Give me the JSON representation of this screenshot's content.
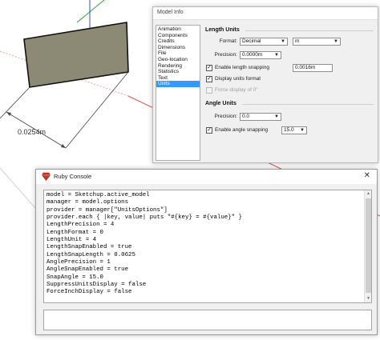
{
  "viewport": {
    "dimension_label": "0.0254m"
  },
  "model_info": {
    "title": "Model Info",
    "categories": [
      {
        "label": "Animation",
        "selected": false
      },
      {
        "label": "Components",
        "selected": false
      },
      {
        "label": "Credits",
        "selected": false
      },
      {
        "label": "Dimensions",
        "selected": false
      },
      {
        "label": "File",
        "selected": false
      },
      {
        "label": "Geo-location",
        "selected": false
      },
      {
        "label": "Rendering",
        "selected": false
      },
      {
        "label": "Statistics",
        "selected": false
      },
      {
        "label": "Text",
        "selected": false
      },
      {
        "label": "Units",
        "selected": true
      }
    ],
    "length_units": {
      "heading": "Length Units",
      "format_label": "Format:",
      "format_value": "Decimal",
      "unit_value": "m",
      "precision_label": "Precision:",
      "precision_value": "0.0000m",
      "enable_snapping_label": "Enable length snapping",
      "enable_snapping_checked": true,
      "snap_value": "0.0016m",
      "display_format_label": "Display units format",
      "display_format_checked": true,
      "force_display_label": "Force display of 0\"",
      "force_display_checked": false
    },
    "angle_units": {
      "heading": "Angle Units",
      "precision_label": "Precision:",
      "precision_value": "0.0",
      "enable_snapping_label": "Enable angle snapping",
      "enable_snapping_checked": true,
      "snap_value": "15.0"
    }
  },
  "ruby_console": {
    "title": "Ruby Console",
    "output_lines": [
      "model = Sketchup.active_model",
      "manager = model.options",
      "provider = manager[\"UnitsOptions\"]",
      "provider.each { |key, value| puts \"#{key} = #{value}\" }",
      "LengthPrecision = 4",
      "LengthFormat = 0",
      "LengthUnit = 4",
      "LengthSnapEnabled = true",
      "LengthSnapLength = 0.0625",
      "AnglePrecision = 1",
      "AngleSnapEnabled = true",
      "SnapAngle = 15.0",
      "SuppressUnitsDisplay = false",
      "ForceInchDisplay = false"
    ],
    "input_value": ""
  },
  "colors": {
    "selection": "#3399ff",
    "face_fill": "#8c8a74",
    "axis_red": "#d9534f",
    "axis_green": "#2e9e3e",
    "axis_blue": "#3a4fc6"
  }
}
